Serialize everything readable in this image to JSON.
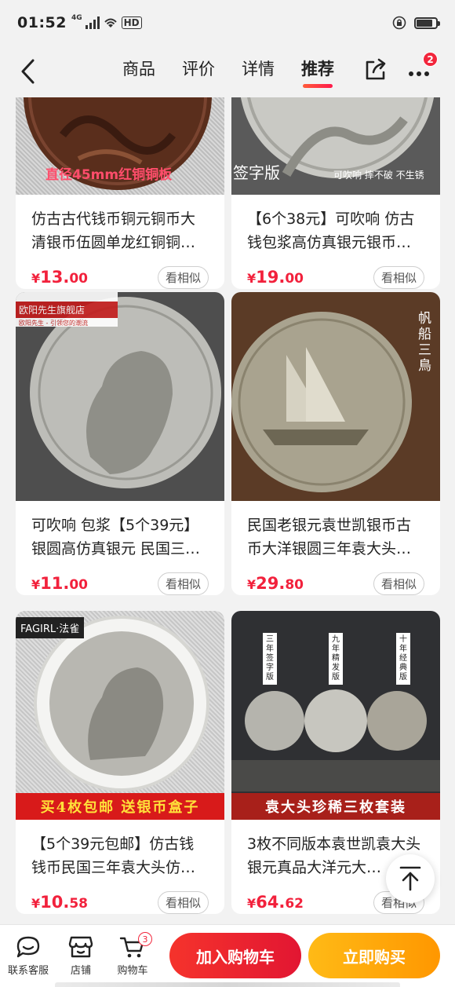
{
  "status": {
    "time": "01:52",
    "network": "4G",
    "wifi": "HD"
  },
  "nav": {
    "tabs": [
      {
        "label": "商品"
      },
      {
        "label": "评价"
      },
      {
        "label": "详情"
      },
      {
        "label": "推荐"
      }
    ],
    "active_tab": "推荐",
    "more_badge": "2"
  },
  "products": [
    {
      "title": "仿古古代钱币铜元铜币大清银币伍圆单龙红铜铜…",
      "price_cur": "¥",
      "price_int": "13.",
      "price_dec": "00",
      "similar": "看相似",
      "image_caption": "直径45mm红铜铜板"
    },
    {
      "title": "【6个38元】可吹响 仿古钱包浆高仿真银元银币…",
      "price_cur": "¥",
      "price_int": "19.",
      "price_dec": "00",
      "similar": "看相似",
      "image_caption": "签字版",
      "image_caption2": "可吹响 摔不破 不生锈"
    },
    {
      "title": "可吹响 包浆【5个39元】银圆高仿真银元 民国三…",
      "price_cur": "¥",
      "price_int": "11.",
      "price_dec": "00",
      "similar": "看相似",
      "image_caption": "欧阳先生旗舰店",
      "image_caption2": "欧阳先生 - 引领您的潮流"
    },
    {
      "title": "民国老银元袁世凯银币古币大洋银圆三年袁大头…",
      "price_cur": "¥",
      "price_int": "29.",
      "price_dec": "80",
      "similar": "看相似",
      "image_caption": "帆船三鳥"
    },
    {
      "title": "【5个39元包邮】仿古钱钱币民国三年袁大头仿…",
      "price_cur": "¥",
      "price_int": "10.",
      "price_dec": "58",
      "similar": "看相似",
      "image_caption": "FAGIRL·法雀",
      "image_caption2": "买4枚包邮 送银币盒子"
    },
    {
      "title": "3枚不同版本袁世凯袁大头银元真品大洋元大…",
      "price_cur": "¥",
      "price_int": "64.",
      "price_dec": "62",
      "similar": "看相似",
      "image_caption": "袁大头珍稀三枚套装",
      "coin_labels": [
        "三年签字版",
        "九年精发版",
        "十年经典版"
      ]
    }
  ],
  "bottom": {
    "service": "联系客服",
    "store": "店铺",
    "cart": "购物车",
    "cart_count": "3",
    "add_to_cart": "加入购物车",
    "buy_now": "立即购买"
  },
  "colors": {
    "price_red": "#f2213c",
    "cart_btn": "#e8202f",
    "buy_btn": "#ffa60d"
  }
}
